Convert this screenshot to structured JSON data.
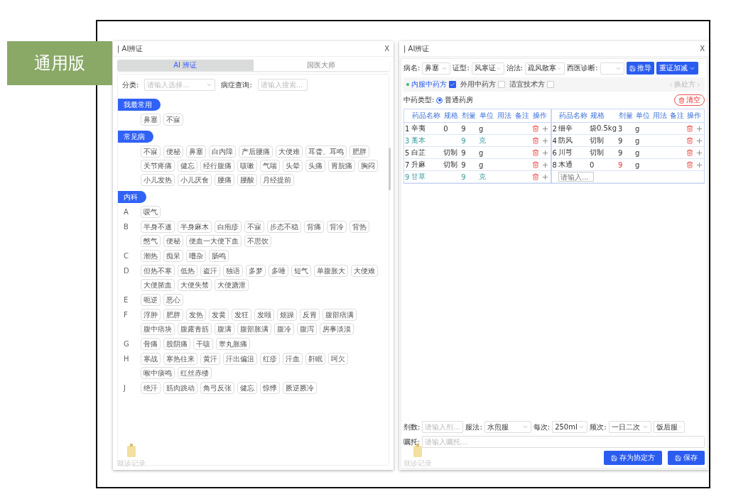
{
  "badge": {
    "label": "通用版"
  },
  "left_panel": {
    "title": "| AI辨证",
    "close": "X",
    "tabs": [
      {
        "label": "AI 辨证",
        "selected": true
      },
      {
        "label": "国医大师",
        "selected": false
      }
    ],
    "filters": [
      {
        "label": "分类:",
        "placeholder": "请输入选择..."
      },
      {
        "label": "病症查询:",
        "placeholder": "请输入搜索..."
      }
    ],
    "sections": [
      {
        "title": "我最常用",
        "groups": [
          {
            "items": [
              "鼻塞",
              "不寐"
            ]
          }
        ]
      },
      {
        "title": "常见病",
        "groups": [
          {
            "items": [
              "不寐",
              "便秘",
              "鼻塞",
              "白内障",
              "产后腰痛",
              "大便难",
              "耳聋、耳鸣",
              "肥胖",
              "关节疼痛",
              "健忘",
              "经行腹痛",
              "咳嗽",
              "气喘",
              "头晕",
              "头痛",
              "胃脘痛",
              "胸闷",
              "小儿发热",
              "小儿厌食",
              "腰痛",
              "腰酸",
              "月经提前"
            ]
          }
        ]
      },
      {
        "title": "内科",
        "groups": [
          {
            "letter": "A",
            "items": [
              "嗳气"
            ]
          },
          {
            "letter": "B",
            "items": [
              "半身不遂",
              "半身麻木",
              "白疱疹",
              "不寐",
              "步态不稳",
              "背痛",
              "背冷",
              "背热",
              "憋气",
              "便秘",
              "便血一大便下血",
              "不思饮"
            ]
          },
          {
            "letter": "C",
            "items": [
              "潮热",
              "痴呆",
              "嘈杂",
              "肠鸣"
            ]
          },
          {
            "letter": "D",
            "items": [
              "但热不寒",
              "低热",
              "盗汗",
              "独语",
              "多梦",
              "多唾",
              "短气",
              "单腹胀大",
              "大便难",
              "大便脓血",
              "大便失禁",
              "大便溏泄"
            ]
          },
          {
            "letter": "E",
            "items": [
              "呃逆",
              "恶心"
            ]
          },
          {
            "letter": "F",
            "items": [
              "浮肿",
              "肥胖",
              "发热",
              "发黄",
              "发狂",
              "发颐",
              "烦躁",
              "反胃",
              "腹部痞满",
              "腹中痞块",
              "腹露青筋",
              "腹满",
              "腹部胀满",
              "腹冷",
              "腹泻",
              "房事淡漠"
            ]
          },
          {
            "letter": "G",
            "items": [
              "骨痛",
              "股阴痛",
              "干咳",
              "睾丸胀痛"
            ]
          },
          {
            "letter": "H",
            "items": [
              "寒战",
              "寒热往来",
              "黄汗",
              "汗出偏沮",
              "红疹",
              "汗血",
              "鼾眠",
              "呵欠",
              "喉中痰鸣",
              "红丝赤缕"
            ]
          },
          {
            "letter": "J",
            "items": [
              "绝汗",
              "筋肉跳动",
              "角弓反张",
              "健忘",
              "惊悸",
              "厥逆厥冷"
            ]
          }
        ]
      }
    ],
    "record_button": {
      "label": "就诊记录"
    }
  },
  "right_panel": {
    "title": "| AI辨证",
    "close": "X",
    "fields": [
      {
        "label": "病名:",
        "value": "鼻塞"
      },
      {
        "label": "证型:",
        "value": "风寒证"
      },
      {
        "label": "治法:",
        "value": "疏风散寒"
      },
      {
        "label": "西医诊断:"
      }
    ],
    "actions": [
      {
        "label": "推导",
        "kind": "icon"
      },
      {
        "label": "重证加减",
        "kind": "menu"
      }
    ],
    "prescription_tabs": [
      {
        "label": "内服中药方",
        "selected": true,
        "checked": true
      },
      {
        "label": "外用中药方",
        "selected": false,
        "checked": false
      },
      {
        "label": "适宜技术方",
        "selected": false,
        "checked": false
      }
    ],
    "switch_label": "换处方",
    "type_label": "中药类型:",
    "type_options": [
      {
        "label": "普通药房",
        "selected": true
      }
    ],
    "clear_button": "清空",
    "halves": [
      {
        "columns": [
          "药品名称",
          "规格",
          "剂量",
          "单位",
          "用法",
          "备注",
          "操作"
        ],
        "rows": [
          {
            "index": "1",
            "name": "辛夷",
            "spec": "0",
            "dose": "9",
            "unit": "g",
            "highlighted": false,
            "dose_alert": false
          },
          {
            "index": "3",
            "name": "藁本",
            "dose": "9",
            "unit": "克",
            "highlighted": true,
            "dose_alert": false
          },
          {
            "index": "5",
            "name": "白芷",
            "spec": "切制",
            "dose": "9",
            "unit": "g",
            "highlighted": false,
            "dose_alert": false
          },
          {
            "index": "7",
            "name": "升麻",
            "spec": "切制",
            "dose": "9",
            "unit": "g",
            "highlighted": false,
            "dose_alert": false
          },
          {
            "index": "9",
            "name": "甘草",
            "dose": "9",
            "unit": "克",
            "highlighted": true,
            "dose_alert": false
          }
        ]
      },
      {
        "columns": [
          "药品名称",
          "规格",
          "剂量",
          "单位",
          "用法",
          "备注",
          "操作"
        ],
        "rows": [
          {
            "index": "2",
            "name": "细辛",
            "spec": "袋0.5kg",
            "dose": "3",
            "unit": "g",
            "highlighted": false,
            "dose_alert": false
          },
          {
            "index": "4",
            "name": "防风",
            "spec": "切制",
            "dose": "9",
            "unit": "g",
            "highlighted": false,
            "dose_alert": false
          },
          {
            "index": "6",
            "name": "川芎",
            "spec": "切制",
            "dose": "9",
            "unit": "g",
            "highlighted": false,
            "dose_alert": false
          },
          {
            "index": "8",
            "name": "木通",
            "spec": "0",
            "dose": "9",
            "unit": "g",
            "highlighted": false,
            "dose_alert": true
          }
        ],
        "input_placeholder": "请输入..."
      }
    ],
    "dosage": [
      {
        "label": "剂数:",
        "placeholder": "请输入剂..."
      },
      {
        "label": "服法:",
        "value": "水煎服"
      },
      {
        "label": "每次:",
        "value": "250ml"
      },
      {
        "label": "频次:",
        "value": "一日二次"
      },
      {
        "value": "饭后服"
      }
    ],
    "instructions": {
      "label": "嘱托:",
      "placeholder": "请输入嘱托..."
    },
    "buttons": [
      "存为协定方",
      "保存"
    ],
    "record_button": {
      "label": "就诊记录"
    }
  }
}
